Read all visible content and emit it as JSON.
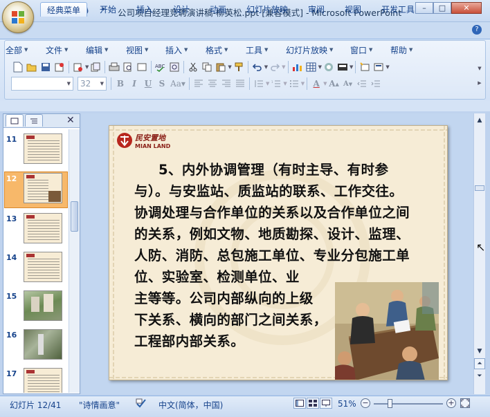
{
  "window": {
    "title": "公司项目经理竞聘演讲稿-柳英松.ppt [兼容模式] - Microsoft PowerPoint",
    "minimize": "–",
    "maximize": "□",
    "close": "✕"
  },
  "ribbon_tabs": [
    {
      "label": "经典菜单",
      "active": true
    },
    {
      "label": "开始"
    },
    {
      "label": "插入"
    },
    {
      "label": "设计"
    },
    {
      "label": "动画"
    },
    {
      "label": "幻灯片放映"
    },
    {
      "label": "审阅"
    },
    {
      "label": "视图"
    },
    {
      "label": "开发工具"
    }
  ],
  "menus": [
    "全部",
    "文件",
    "编辑",
    "视图",
    "插入",
    "格式",
    "工具",
    "幻灯片放映",
    "窗口",
    "帮助"
  ],
  "font_size_value": "32",
  "font_name_value": "",
  "thumbnails": [
    {
      "num": "11",
      "kind": "text"
    },
    {
      "num": "12",
      "kind": "text",
      "selected": true
    },
    {
      "num": "13",
      "kind": "text"
    },
    {
      "num": "14",
      "kind": "text"
    },
    {
      "num": "15",
      "kind": "photo"
    },
    {
      "num": "16",
      "kind": "photo"
    },
    {
      "num": "17",
      "kind": "text"
    }
  ],
  "slide": {
    "logo_cn": "民安置地",
    "logo_en": "MIAN LAND",
    "lines": [
      "5、内外协调管理（有时主导、有时参",
      "与）。与安监站、质监站的联系、工作交往。",
      "协调处理与合作单位的关系以及合作单位之间",
      "的关系，例如文物、地质勘探、设计、监理、",
      "人防、消防、总包施工单位、专业分包施工单",
      "位、实验室、检测单位、业",
      "主等等。公司内部纵向的上级",
      "下关系、横向的部门之间关系，",
      "工程部内部关系。"
    ]
  },
  "status": {
    "slide_info": "幻灯片 12/41",
    "theme": "\"诗情画意\"",
    "language": "中文(简体，中国)",
    "zoom": "51%"
  },
  "colors": {
    "accent": "#15428b",
    "ribbon_bg": "#dbe7f6",
    "slide_bg": "#f6ecd6",
    "selection": "#f7b86a"
  }
}
